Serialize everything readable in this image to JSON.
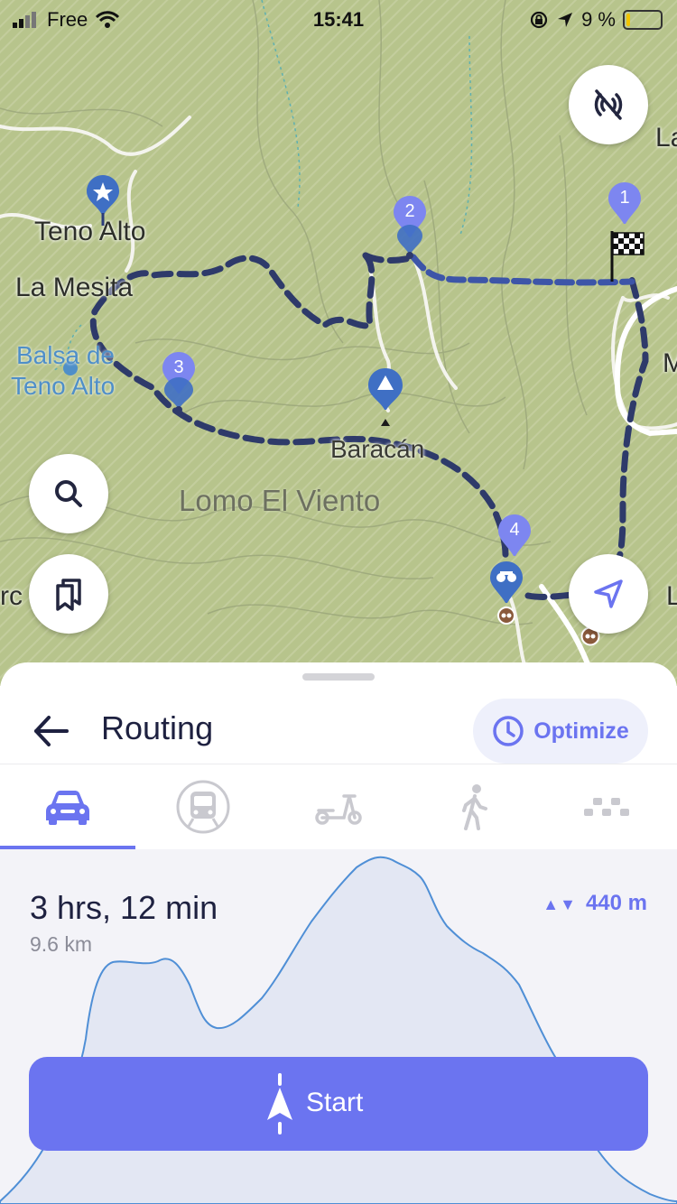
{
  "status_bar": {
    "carrier": "Free",
    "time": "15:41",
    "battery": "9 %"
  },
  "map": {
    "labels": {
      "teno_alto": "Teno Alto",
      "la_mesita": "La Mesita",
      "balsa_line1": "Balsa de",
      "balsa_line2": "Teno Alto",
      "baracan": "Baracán",
      "lomo": "Lomo El Viento",
      "edge_la": "La",
      "edge_m": "M",
      "edge_rc": "rc",
      "edge_l": "L"
    },
    "waypoints": [
      "1",
      "2",
      "3",
      "4"
    ],
    "colors": {
      "terrain": "#b9c58f",
      "route": "#2e3a6a",
      "pin": "#3f6fc4",
      "waypoint_pin": "#7d86f0"
    }
  },
  "sheet": {
    "title": "Routing",
    "optimize_label": "Optimize",
    "modes": [
      "car",
      "public-transport",
      "scooter",
      "walk",
      "more"
    ],
    "active_mode": "car",
    "duration": "3 hrs, 12 min",
    "distance": "9.6 km",
    "elevation": "440 m",
    "elevation_arrows": "▲▼",
    "start_label": "Start",
    "accent": "#6b74f0"
  }
}
